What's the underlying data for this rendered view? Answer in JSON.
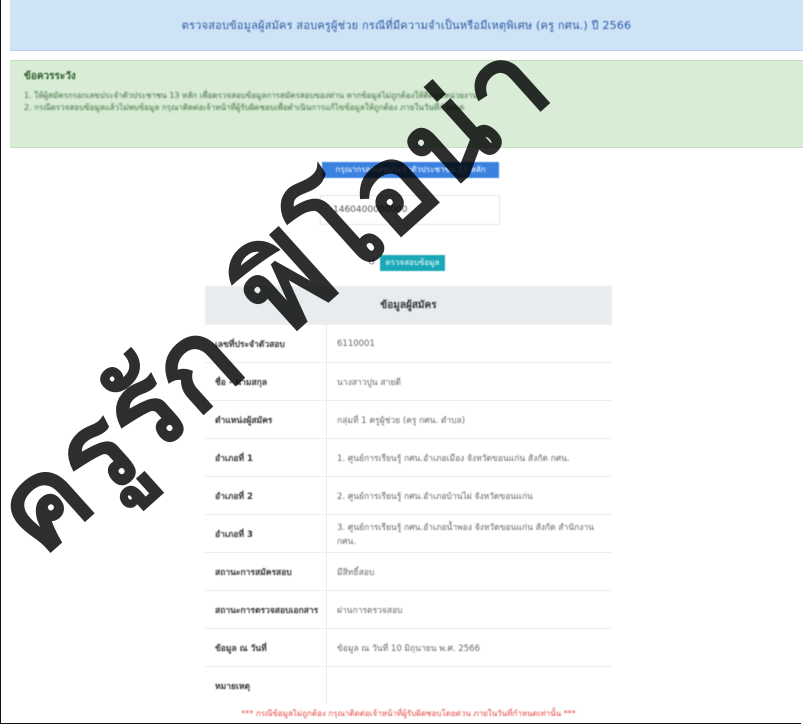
{
  "header": {
    "title": "ตรวจสอบข้อมูลผู้สมัคร สอบครูผู้ช่วย กรณีที่มีความจำเป็นหรือมีเหตุพิเศษ (ครู กศน.) ปี 2566"
  },
  "notice": {
    "title": "ข้อควรระวัง",
    "lines": [
      "1. ให้ผู้สมัครกรอกเลขประจำตัวประชาชน 13 หลัก เพื่อตรวจสอบข้อมูลการสมัครสอบของท่าน หากข้อมูลไม่ถูกต้องให้ติดต่อหน่วยงาน",
      "2. กรณีตรวจสอบข้อมูลแล้วไม่พบข้อมูล กรุณาติดต่อเจ้าหน้าที่ผู้รับผิดชอบเพื่อดำเนินการแก้ไขข้อมูลให้ถูกต้อง ภายในวันที่กำหนด"
    ]
  },
  "search": {
    "selected_text": "กรุณากรอกเลขประจำตัวประชาชน 13 หลัก",
    "id_value": "1460400000000",
    "mini_icon": "↺",
    "button_label": "ตรวจสอบข้อมูล"
  },
  "table": {
    "heading": "ข้อมูลผู้สมัคร",
    "rows": [
      {
        "label": "เลขที่ประจำตัวสอบ",
        "value": "6110001"
      },
      {
        "label": "ชื่อ - นามสกุล",
        "value": "นางสาวปูน สายดี"
      },
      {
        "label": "ตำแหน่งผู้สมัคร",
        "value": "กลุ่มที่ 1 ครูผู้ช่วย (ครู กศน. ตำบล)"
      },
      {
        "label": "อำเภอที่ 1",
        "value": "1. ศูนย์การเรียนรู้ กศน.อำเภอเมือง จังหวัดขอนแก่น สังกัด กศน."
      },
      {
        "label": "อำเภอที่ 2",
        "value": "2. ศูนย์การเรียนรู้ กศน.อำเภอบ้านไผ่ จังหวัดขอนแก่น"
      },
      {
        "label": "อำเภอที่ 3",
        "value": "3. ศูนย์การเรียนรู้ กศน.อำเภอน้ำพอง จังหวัดขอนแก่น สังกัด สำนักงาน กศน."
      },
      {
        "label": "สถานะการสมัครสอบ",
        "value": "มีสิทธิ์สอบ"
      },
      {
        "label": "สถานะการตรวจสอบเอกสาร",
        "value": "ผ่านการตรวจสอบ"
      },
      {
        "label": "ข้อมูล ณ วันที่",
        "value": "ข้อมูล ณ วันที่ 10 มิถุนายน พ.ศ. 2566"
      },
      {
        "label": "หมายเหตุ",
        "value": ""
      }
    ]
  },
  "footnote": "*** กรณีข้อมูลไม่ถูกต้อง กรุณาติดต่อเจ้าหน้าที่ผู้รับผิดชอบโดยด่วน ภายในวันที่กำหนดเท่านั้น ***",
  "watermark": {
    "text": "ครูรัก ฟิโอน่า",
    "color": "#000000"
  },
  "colors": {
    "header_bg": "#cfe3f7",
    "notice_bg": "#d8ecd6",
    "button_bg": "#1aa8b8",
    "selection_bg": "#3b82e0",
    "footnote": "#e0453f"
  }
}
